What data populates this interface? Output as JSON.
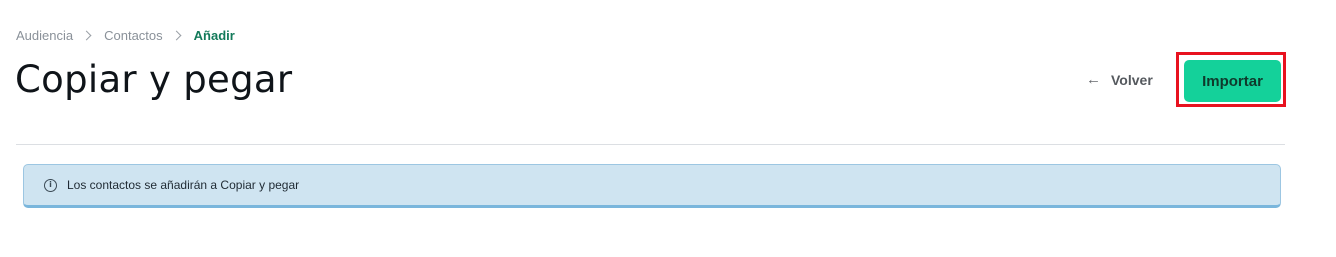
{
  "breadcrumb": {
    "items": [
      "Audiencia",
      "Contactos",
      "Añadir"
    ]
  },
  "page": {
    "title": "Copiar y pegar"
  },
  "actions": {
    "back_label": "Volver",
    "back_arrow": "←",
    "import_label": "Importar"
  },
  "info": {
    "icon": "info-icon",
    "icon_glyph": "i",
    "message": "Los contactos se añadirán a Copiar y pegar"
  },
  "colors": {
    "accent": "#14d19a",
    "active_breadcrumb": "#137a5a",
    "highlight": "#e8121f",
    "banner_bg": "#cfe4f1"
  }
}
